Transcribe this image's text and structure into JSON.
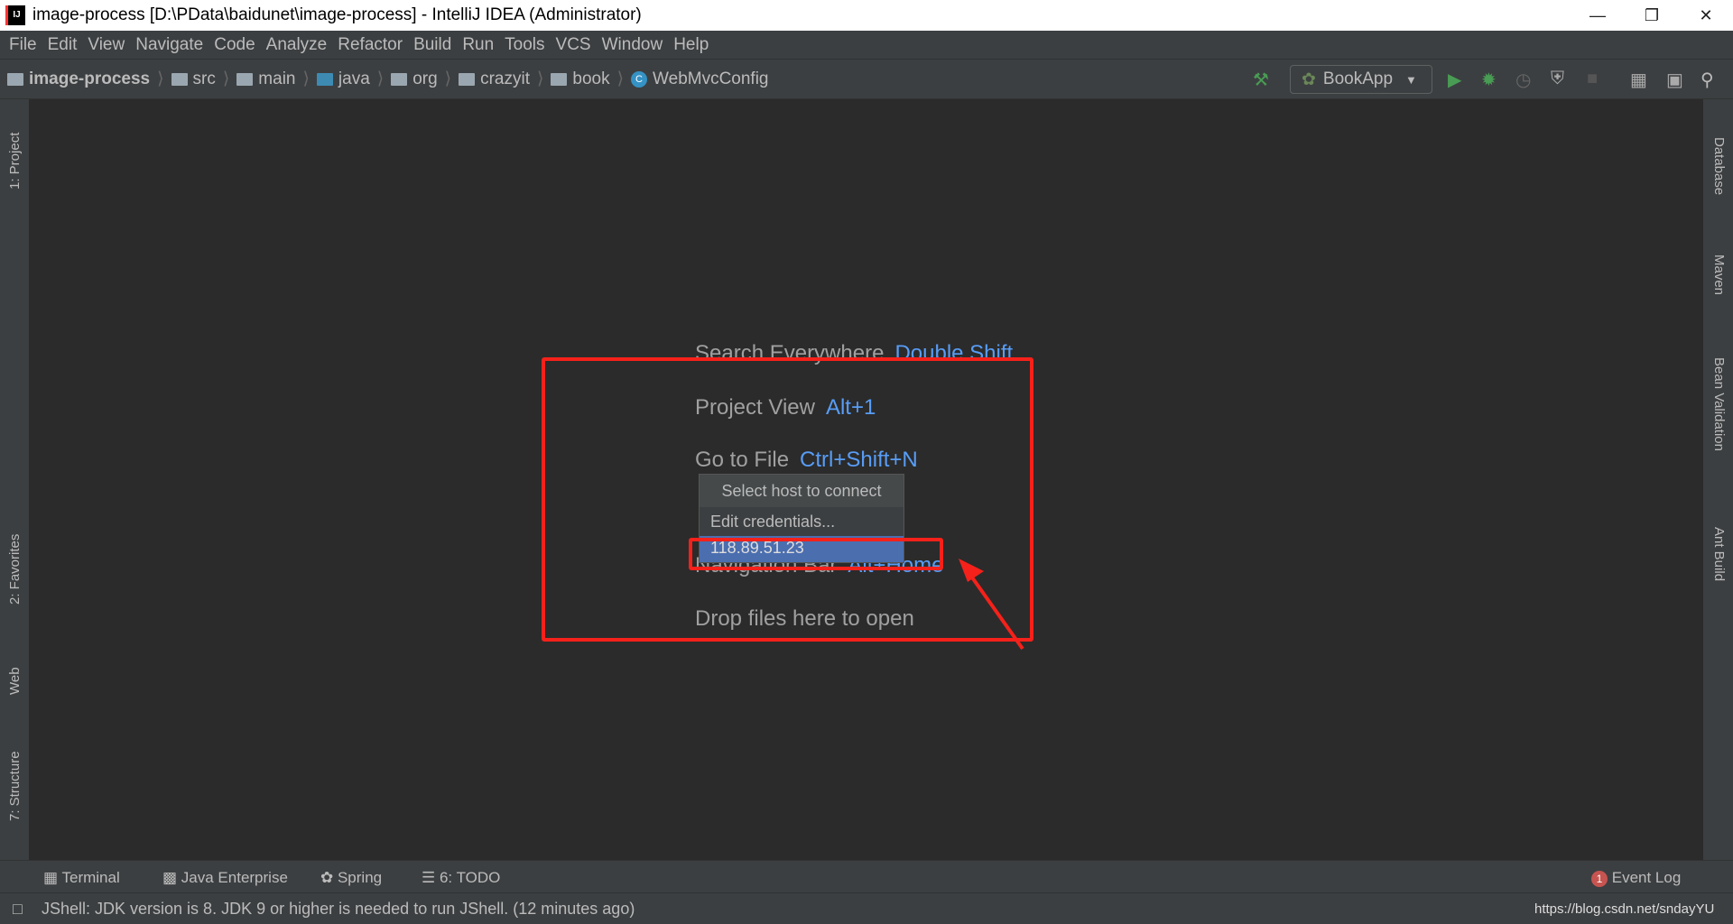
{
  "window": {
    "title": "image-process [D:\\PData\\baidunet\\image-process] - IntelliJ IDEA (Administrator)",
    "logo": "IJ"
  },
  "menu": [
    "File",
    "Edit",
    "View",
    "Navigate",
    "Code",
    "Analyze",
    "Refactor",
    "Build",
    "Run",
    "Tools",
    "VCS",
    "Window",
    "Help"
  ],
  "breadcrumb": [
    "image-process",
    "src",
    "main",
    "java",
    "org",
    "crazyit",
    "book",
    "WebMvcConfig"
  ],
  "run_config": "BookApp",
  "left_tools": [
    "1: Project",
    "2: Favorites",
    "Web",
    "7: Structure"
  ],
  "right_tools": [
    "Database",
    "Maven",
    "Bean Validation",
    "Ant Build"
  ],
  "hints": [
    {
      "label": "Search Everywhere",
      "key": "Double Shift"
    },
    {
      "label": "Project View",
      "key": "Alt+1"
    },
    {
      "label": "Go to File",
      "key": "Ctrl+Shift+N"
    },
    {
      "label": "Navigation Bar",
      "key": "Alt+Home"
    },
    {
      "label": "Drop files here to open",
      "key": ""
    }
  ],
  "popup": {
    "title": "Select host to connect",
    "items": [
      "Edit credentials...",
      "118.89.51.23"
    ],
    "selected": 1
  },
  "tool_windows": [
    "Terminal",
    "Java Enterprise",
    "Spring",
    "6: TODO"
  ],
  "event_log": {
    "label": "Event Log",
    "count": "1"
  },
  "status": {
    "message": "JShell: JDK version is 8. JDK 9 or higher is needed to run JShell. (12 minutes ago)",
    "watermark": "https://blog.csdn.net/sndayYU"
  },
  "colors": {
    "annotation": "#f5211a",
    "selection": "#4b6eaf",
    "shortcut": "#589df6"
  }
}
